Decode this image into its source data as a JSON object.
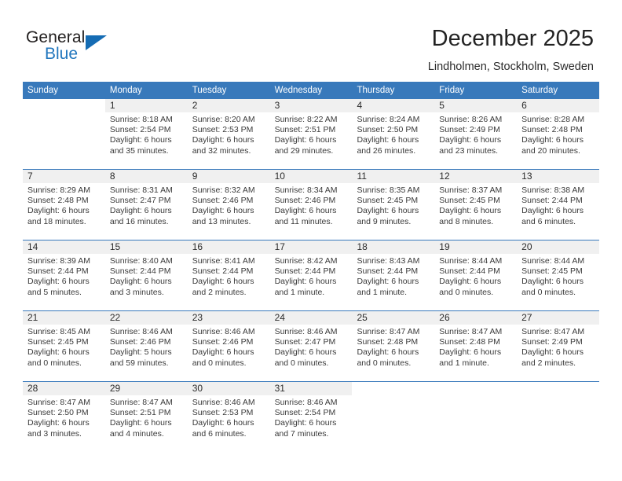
{
  "brand": {
    "name_top": "General",
    "name_bottom": "Blue",
    "accent_color": "#2176bd",
    "triangle_color": "#156cb4"
  },
  "header": {
    "title": "December 2025",
    "subtitle": "Lindholmen, Stockholm, Sweden"
  },
  "calendar": {
    "header_bg": "#3879bb",
    "daynumber_bg": "#f0f0f0",
    "weekdays": [
      "Sunday",
      "Monday",
      "Tuesday",
      "Wednesday",
      "Thursday",
      "Friday",
      "Saturday"
    ],
    "weeks": [
      [
        {
          "day": "",
          "sunrise": "",
          "sunset": "",
          "daylight_1": "",
          "daylight_2": "",
          "blank": true
        },
        {
          "day": "1",
          "sunrise": "Sunrise: 8:18 AM",
          "sunset": "Sunset: 2:54 PM",
          "daylight_1": "Daylight: 6 hours",
          "daylight_2": "and 35 minutes."
        },
        {
          "day": "2",
          "sunrise": "Sunrise: 8:20 AM",
          "sunset": "Sunset: 2:53 PM",
          "daylight_1": "Daylight: 6 hours",
          "daylight_2": "and 32 minutes."
        },
        {
          "day": "3",
          "sunrise": "Sunrise: 8:22 AM",
          "sunset": "Sunset: 2:51 PM",
          "daylight_1": "Daylight: 6 hours",
          "daylight_2": "and 29 minutes."
        },
        {
          "day": "4",
          "sunrise": "Sunrise: 8:24 AM",
          "sunset": "Sunset: 2:50 PM",
          "daylight_1": "Daylight: 6 hours",
          "daylight_2": "and 26 minutes."
        },
        {
          "day": "5",
          "sunrise": "Sunrise: 8:26 AM",
          "sunset": "Sunset: 2:49 PM",
          "daylight_1": "Daylight: 6 hours",
          "daylight_2": "and 23 minutes."
        },
        {
          "day": "6",
          "sunrise": "Sunrise: 8:28 AM",
          "sunset": "Sunset: 2:48 PM",
          "daylight_1": "Daylight: 6 hours",
          "daylight_2": "and 20 minutes."
        }
      ],
      [
        {
          "day": "7",
          "sunrise": "Sunrise: 8:29 AM",
          "sunset": "Sunset: 2:48 PM",
          "daylight_1": "Daylight: 6 hours",
          "daylight_2": "and 18 minutes."
        },
        {
          "day": "8",
          "sunrise": "Sunrise: 8:31 AM",
          "sunset": "Sunset: 2:47 PM",
          "daylight_1": "Daylight: 6 hours",
          "daylight_2": "and 16 minutes."
        },
        {
          "day": "9",
          "sunrise": "Sunrise: 8:32 AM",
          "sunset": "Sunset: 2:46 PM",
          "daylight_1": "Daylight: 6 hours",
          "daylight_2": "and 13 minutes."
        },
        {
          "day": "10",
          "sunrise": "Sunrise: 8:34 AM",
          "sunset": "Sunset: 2:46 PM",
          "daylight_1": "Daylight: 6 hours",
          "daylight_2": "and 11 minutes."
        },
        {
          "day": "11",
          "sunrise": "Sunrise: 8:35 AM",
          "sunset": "Sunset: 2:45 PM",
          "daylight_1": "Daylight: 6 hours",
          "daylight_2": "and 9 minutes."
        },
        {
          "day": "12",
          "sunrise": "Sunrise: 8:37 AM",
          "sunset": "Sunset: 2:45 PM",
          "daylight_1": "Daylight: 6 hours",
          "daylight_2": "and 8 minutes."
        },
        {
          "day": "13",
          "sunrise": "Sunrise: 8:38 AM",
          "sunset": "Sunset: 2:44 PM",
          "daylight_1": "Daylight: 6 hours",
          "daylight_2": "and 6 minutes."
        }
      ],
      [
        {
          "day": "14",
          "sunrise": "Sunrise: 8:39 AM",
          "sunset": "Sunset: 2:44 PM",
          "daylight_1": "Daylight: 6 hours",
          "daylight_2": "and 5 minutes."
        },
        {
          "day": "15",
          "sunrise": "Sunrise: 8:40 AM",
          "sunset": "Sunset: 2:44 PM",
          "daylight_1": "Daylight: 6 hours",
          "daylight_2": "and 3 minutes."
        },
        {
          "day": "16",
          "sunrise": "Sunrise: 8:41 AM",
          "sunset": "Sunset: 2:44 PM",
          "daylight_1": "Daylight: 6 hours",
          "daylight_2": "and 2 minutes."
        },
        {
          "day": "17",
          "sunrise": "Sunrise: 8:42 AM",
          "sunset": "Sunset: 2:44 PM",
          "daylight_1": "Daylight: 6 hours",
          "daylight_2": "and 1 minute."
        },
        {
          "day": "18",
          "sunrise": "Sunrise: 8:43 AM",
          "sunset": "Sunset: 2:44 PM",
          "daylight_1": "Daylight: 6 hours",
          "daylight_2": "and 1 minute."
        },
        {
          "day": "19",
          "sunrise": "Sunrise: 8:44 AM",
          "sunset": "Sunset: 2:44 PM",
          "daylight_1": "Daylight: 6 hours",
          "daylight_2": "and 0 minutes."
        },
        {
          "day": "20",
          "sunrise": "Sunrise: 8:44 AM",
          "sunset": "Sunset: 2:45 PM",
          "daylight_1": "Daylight: 6 hours",
          "daylight_2": "and 0 minutes."
        }
      ],
      [
        {
          "day": "21",
          "sunrise": "Sunrise: 8:45 AM",
          "sunset": "Sunset: 2:45 PM",
          "daylight_1": "Daylight: 6 hours",
          "daylight_2": "and 0 minutes."
        },
        {
          "day": "22",
          "sunrise": "Sunrise: 8:46 AM",
          "sunset": "Sunset: 2:46 PM",
          "daylight_1": "Daylight: 5 hours",
          "daylight_2": "and 59 minutes."
        },
        {
          "day": "23",
          "sunrise": "Sunrise: 8:46 AM",
          "sunset": "Sunset: 2:46 PM",
          "daylight_1": "Daylight: 6 hours",
          "daylight_2": "and 0 minutes."
        },
        {
          "day": "24",
          "sunrise": "Sunrise: 8:46 AM",
          "sunset": "Sunset: 2:47 PM",
          "daylight_1": "Daylight: 6 hours",
          "daylight_2": "and 0 minutes."
        },
        {
          "day": "25",
          "sunrise": "Sunrise: 8:47 AM",
          "sunset": "Sunset: 2:48 PM",
          "daylight_1": "Daylight: 6 hours",
          "daylight_2": "and 0 minutes."
        },
        {
          "day": "26",
          "sunrise": "Sunrise: 8:47 AM",
          "sunset": "Sunset: 2:48 PM",
          "daylight_1": "Daylight: 6 hours",
          "daylight_2": "and 1 minute."
        },
        {
          "day": "27",
          "sunrise": "Sunrise: 8:47 AM",
          "sunset": "Sunset: 2:49 PM",
          "daylight_1": "Daylight: 6 hours",
          "daylight_2": "and 2 minutes."
        }
      ],
      [
        {
          "day": "28",
          "sunrise": "Sunrise: 8:47 AM",
          "sunset": "Sunset: 2:50 PM",
          "daylight_1": "Daylight: 6 hours",
          "daylight_2": "and 3 minutes."
        },
        {
          "day": "29",
          "sunrise": "Sunrise: 8:47 AM",
          "sunset": "Sunset: 2:51 PM",
          "daylight_1": "Daylight: 6 hours",
          "daylight_2": "and 4 minutes."
        },
        {
          "day": "30",
          "sunrise": "Sunrise: 8:46 AM",
          "sunset": "Sunset: 2:53 PM",
          "daylight_1": "Daylight: 6 hours",
          "daylight_2": "and 6 minutes."
        },
        {
          "day": "31",
          "sunrise": "Sunrise: 8:46 AM",
          "sunset": "Sunset: 2:54 PM",
          "daylight_1": "Daylight: 6 hours",
          "daylight_2": "and 7 minutes."
        },
        {
          "day": "",
          "sunrise": "",
          "sunset": "",
          "daylight_1": "",
          "daylight_2": "",
          "blank": true
        },
        {
          "day": "",
          "sunrise": "",
          "sunset": "",
          "daylight_1": "",
          "daylight_2": "",
          "blank": true
        },
        {
          "day": "",
          "sunrise": "",
          "sunset": "",
          "daylight_1": "",
          "daylight_2": "",
          "blank": true
        }
      ]
    ]
  }
}
